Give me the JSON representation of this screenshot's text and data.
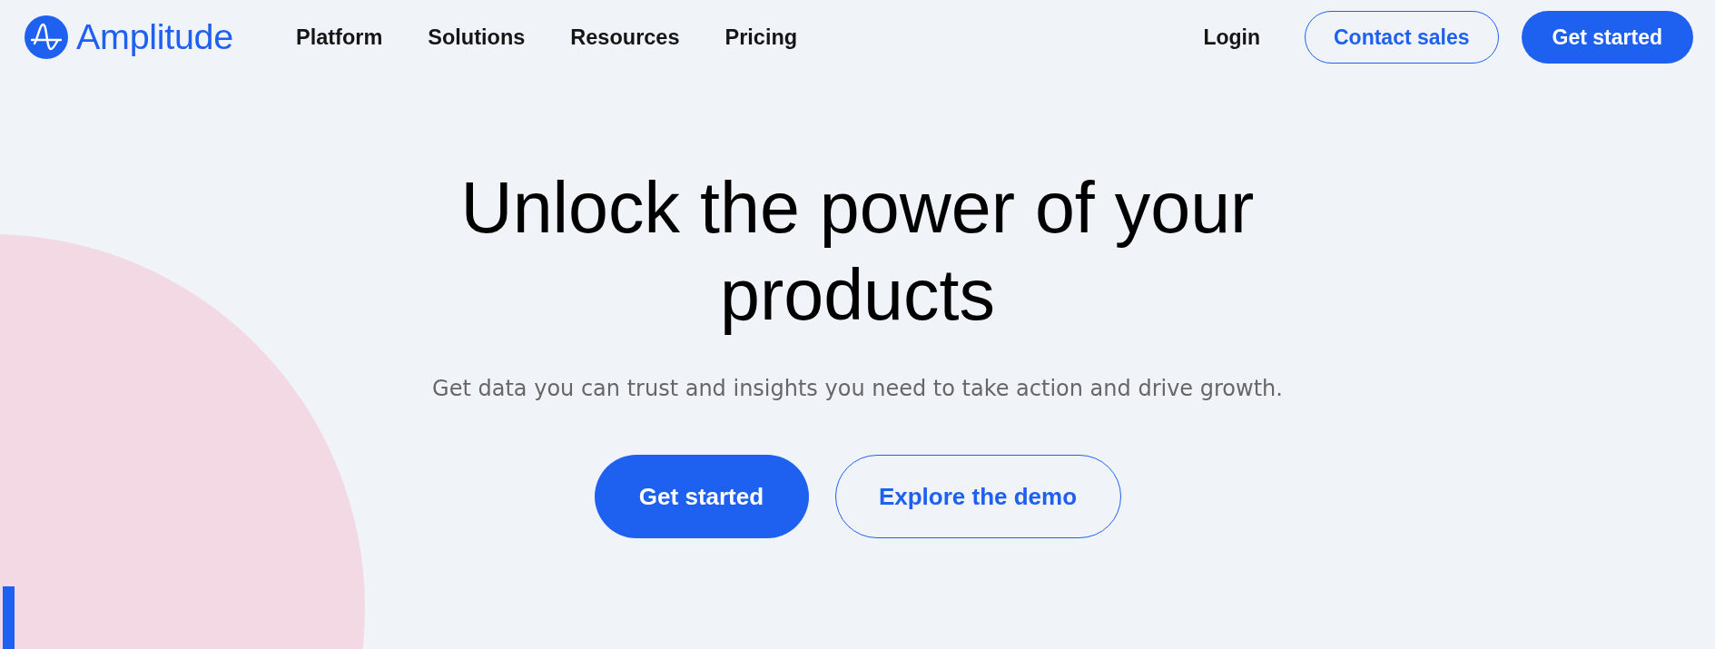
{
  "header": {
    "logo": {
      "text": "Amplitude"
    },
    "nav": [
      "Platform",
      "Solutions",
      "Resources",
      "Pricing"
    ],
    "actions": [
      {
        "label": "Login",
        "kind": "link"
      },
      {
        "label": "Contact sales",
        "kind": "outline"
      },
      {
        "label": "Get started",
        "kind": "primary"
      }
    ]
  },
  "hero": {
    "title": "Unlock the power of your products",
    "subtitle": "Get data you can trust and insights you need to take action and drive growth.",
    "buttons": [
      {
        "label": "Get started",
        "kind": "primary"
      },
      {
        "label": "Explore the demo",
        "kind": "outline"
      }
    ]
  }
}
